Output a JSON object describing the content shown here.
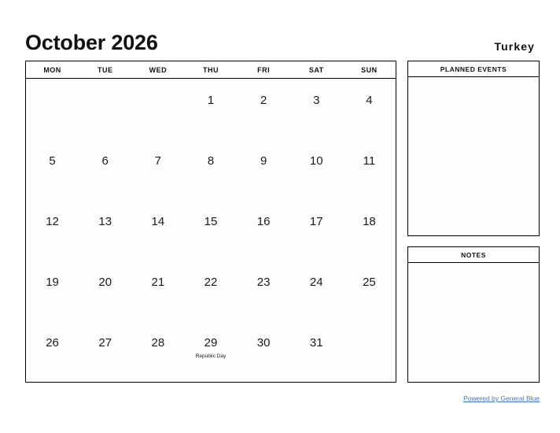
{
  "header": {
    "title": "October 2026",
    "country": "Turkey"
  },
  "calendar": {
    "weekdays": [
      "MON",
      "TUE",
      "WED",
      "THU",
      "FRI",
      "SAT",
      "SUN"
    ],
    "weeks": [
      [
        {
          "day": "",
          "event": ""
        },
        {
          "day": "",
          "event": ""
        },
        {
          "day": "",
          "event": ""
        },
        {
          "day": "1",
          "event": ""
        },
        {
          "day": "2",
          "event": ""
        },
        {
          "day": "3",
          "event": ""
        },
        {
          "day": "4",
          "event": ""
        }
      ],
      [
        {
          "day": "5",
          "event": ""
        },
        {
          "day": "6",
          "event": ""
        },
        {
          "day": "7",
          "event": ""
        },
        {
          "day": "8",
          "event": ""
        },
        {
          "day": "9",
          "event": ""
        },
        {
          "day": "10",
          "event": ""
        },
        {
          "day": "11",
          "event": ""
        }
      ],
      [
        {
          "day": "12",
          "event": ""
        },
        {
          "day": "13",
          "event": ""
        },
        {
          "day": "14",
          "event": ""
        },
        {
          "day": "15",
          "event": ""
        },
        {
          "day": "16",
          "event": ""
        },
        {
          "day": "17",
          "event": ""
        },
        {
          "day": "18",
          "event": ""
        }
      ],
      [
        {
          "day": "19",
          "event": ""
        },
        {
          "day": "20",
          "event": ""
        },
        {
          "day": "21",
          "event": ""
        },
        {
          "day": "22",
          "event": ""
        },
        {
          "day": "23",
          "event": ""
        },
        {
          "day": "24",
          "event": ""
        },
        {
          "day": "25",
          "event": ""
        }
      ],
      [
        {
          "day": "26",
          "event": ""
        },
        {
          "day": "27",
          "event": ""
        },
        {
          "day": "28",
          "event": ""
        },
        {
          "day": "29",
          "event": "Republic Day"
        },
        {
          "day": "30",
          "event": ""
        },
        {
          "day": "31",
          "event": ""
        },
        {
          "day": "",
          "event": ""
        }
      ]
    ]
  },
  "panels": {
    "events_title": "PLANNED EVENTS",
    "notes_title": "NOTES"
  },
  "footer": {
    "link_label": "Powered by General Blue"
  },
  "colors": {
    "link": "#4472c4",
    "border": "#000000",
    "text": "#1a1a1a"
  }
}
